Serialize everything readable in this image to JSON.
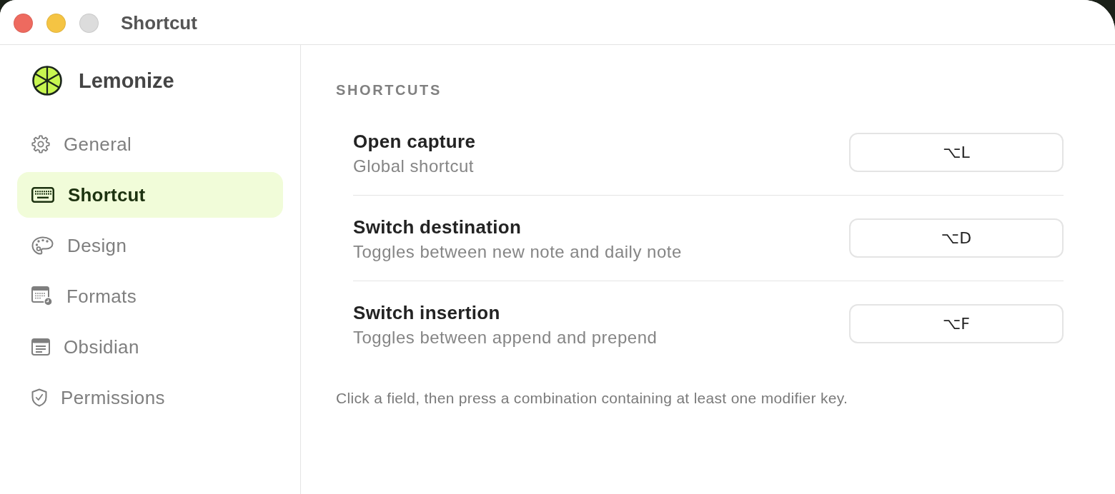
{
  "window": {
    "title": "Shortcut",
    "controls": [
      {
        "kind": "close",
        "disabled": false
      },
      {
        "kind": "minimize",
        "disabled": false
      },
      {
        "kind": "zoom",
        "disabled": true
      }
    ]
  },
  "sidebar": {
    "app_name": "Lemonize",
    "items": [
      {
        "label": "General",
        "selected": false
      },
      {
        "label": "Shortcut",
        "selected": true
      },
      {
        "label": "Design",
        "selected": false
      },
      {
        "label": "Formats",
        "selected": false
      },
      {
        "label": "Obsidian",
        "selected": false
      },
      {
        "label": "Permissions",
        "selected": false
      }
    ]
  },
  "section": {
    "heading": "SHORTCUTS",
    "rows": [
      {
        "title": "Open capture",
        "description": "Global shortcut",
        "shortcut": "⌥L"
      },
      {
        "title": "Switch destination",
        "description": "Toggles between new note and daily note",
        "shortcut": "⌥D"
      },
      {
        "title": "Switch insertion",
        "description": "Toggles between append and prepend",
        "shortcut": "⌥F"
      }
    ],
    "hint": "Click a field, then press a combination containing at least one modifier key."
  }
}
